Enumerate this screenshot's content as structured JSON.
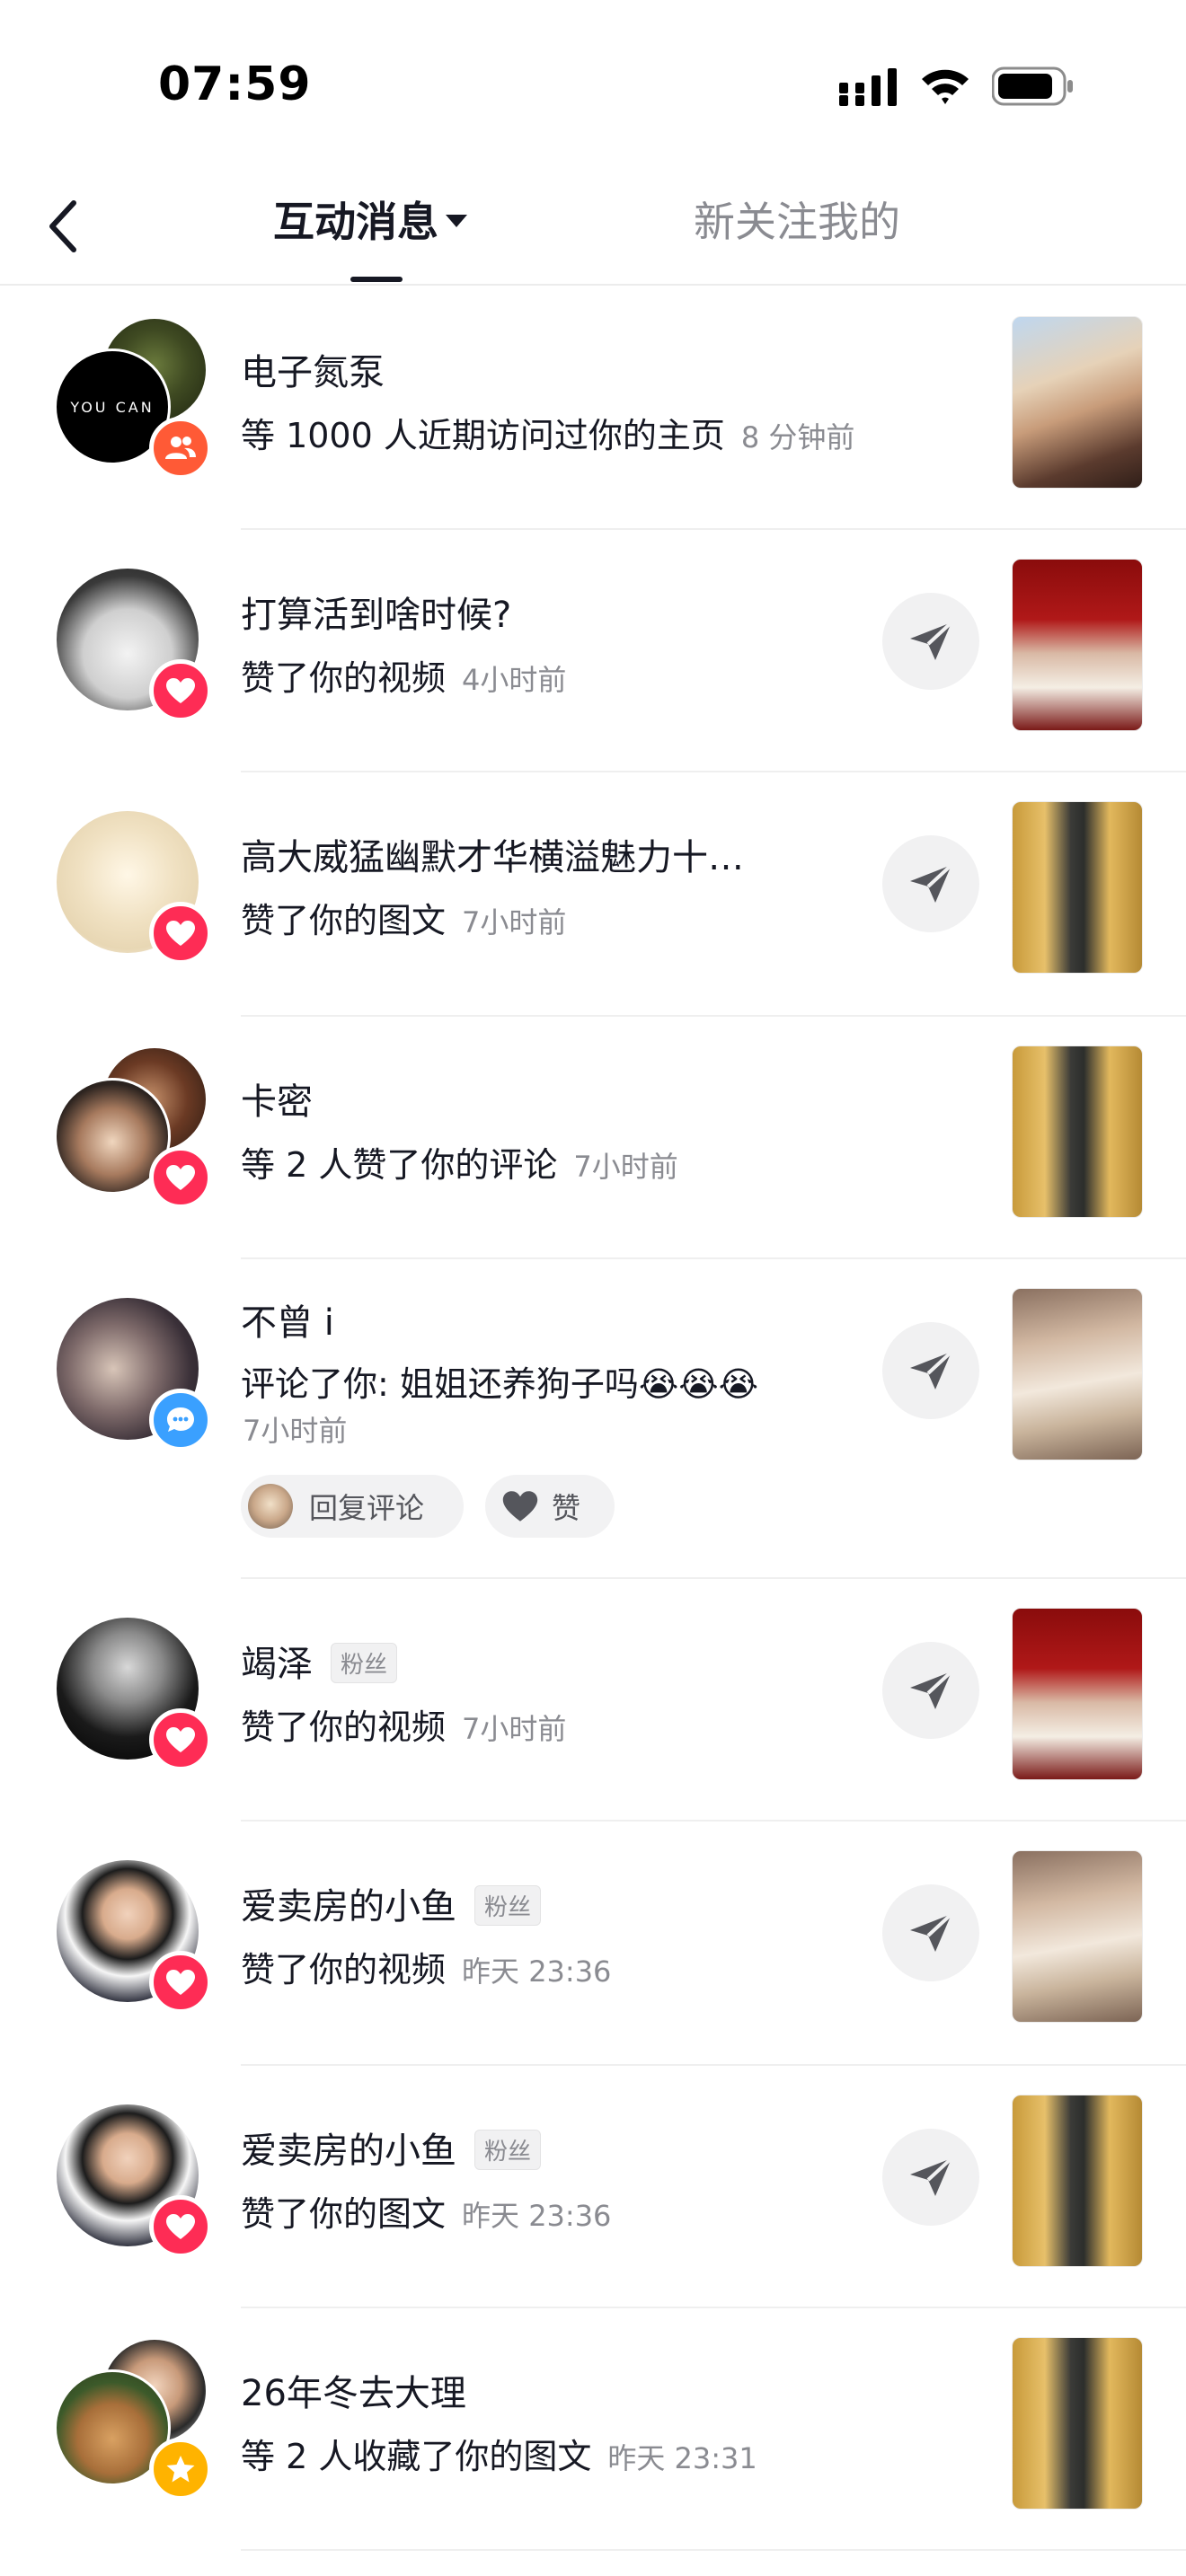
{
  "status_bar": {
    "time": "07:59"
  },
  "header": {
    "tab_active": "互动消息",
    "tab_inactive": "新关注我的"
  },
  "notifications": [
    {
      "name": "电子氮泵",
      "desc": "等 1000 人近期访问过你的主页",
      "time": "8 分钟前",
      "badge": "profile-visit",
      "share": false
    },
    {
      "name": "打算活到啥时候?",
      "desc": "赞了你的视频",
      "time": "4小时前",
      "badge": "like",
      "share": true
    },
    {
      "name": "高大威猛幽默才华横溢魅力十…",
      "desc": "赞了你的图文",
      "time": "7小时前",
      "badge": "like",
      "share": true
    },
    {
      "name": "卡密",
      "desc": "等 2 人赞了你的评论",
      "time": "7小时前",
      "badge": "like",
      "share": false
    },
    {
      "name": "不曾 i",
      "desc": "评论了你: 姐姐还养狗子吗😭😭😭",
      "time": "7小时前",
      "badge": "comment",
      "share": true,
      "reply_label": "回复评论",
      "like_label": "赞"
    },
    {
      "name": "竭泽",
      "tag": "粉丝",
      "desc": "赞了你的视频",
      "time": "7小时前",
      "badge": "like",
      "share": true
    },
    {
      "name": "爱卖房的小鱼",
      "tag": "粉丝",
      "desc": "赞了你的视频",
      "time": "昨天 23:36",
      "badge": "like",
      "share": true
    },
    {
      "name": "爱卖房的小鱼",
      "tag": "粉丝",
      "desc": "赞了你的图文",
      "time": "昨天 23:36",
      "badge": "like",
      "share": true
    },
    {
      "name": "26年冬去大理",
      "desc": "等 2 人收藏了你的图文",
      "time": "昨天 23:31",
      "badge": "favorite",
      "share": false
    }
  ],
  "avatar_text": "YOU CAN",
  "colors": {
    "like_red": "#fe2c55",
    "visit_orange": "#ff5a36",
    "comment_blue": "#3aa0ff",
    "fav_gold": "#ffb300",
    "muted": "#8a8b91"
  }
}
